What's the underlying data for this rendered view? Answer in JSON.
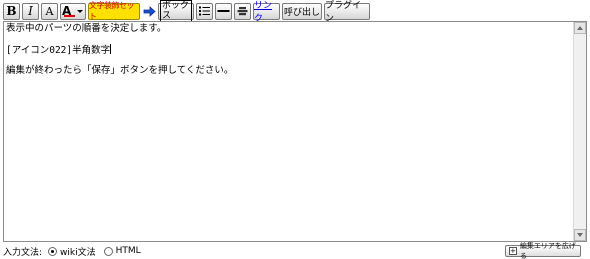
{
  "toolbar": {
    "bold_label": "B",
    "italic_label": "I",
    "font_label": "A",
    "color_label": "A",
    "deco_label": "文字装飾セット",
    "box_label": "ボックス",
    "link_label": "リンク",
    "call_label": "呼び出し",
    "plugin_label": "プラグイン"
  },
  "editor": {
    "lines": [
      "表示中のパーツの順番を決定します。",
      "[アイコン022]半角数字",
      "編集が終わったら「保存」ボタンを押してください。"
    ]
  },
  "bottom": {
    "syntax_label": "入力文法:",
    "options": [
      {
        "label": "wiki文法",
        "selected": true
      },
      {
        "label": "HTML",
        "selected": false
      }
    ],
    "expand_label": "編集エリアを広げる"
  },
  "colors": {
    "deco_bg": "#ffe000",
    "deco_text": "#d00000",
    "link_text": "#0000ee",
    "arrow": "#1a4fd0"
  }
}
